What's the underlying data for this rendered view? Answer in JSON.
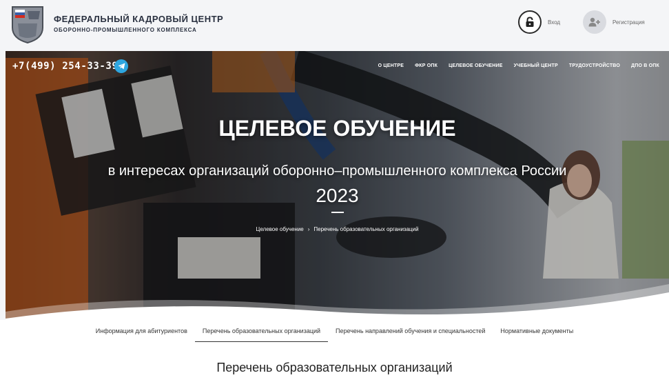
{
  "header": {
    "org_name_line1": "ФЕДЕРАЛЬНЫЙ КАДРОВЫЙ ЦЕНТР",
    "org_name_line2": "ОБОРОННО-ПРОМЫШЛЕННОГО КОМПЛЕКСА",
    "login_label": "Вход",
    "register_label": "Регистрация"
  },
  "hero": {
    "phone": "+7(499) 254-33-39",
    "nav": [
      "О ЦЕНТРЕ",
      "ФКР ОПК",
      "ЦЕЛЕВОЕ ОБУЧЕНИЕ",
      "УЧЕБНЫЙ ЦЕНТР",
      "ТРУДОУСТРОЙСТВО",
      "ДПО В ОПК"
    ],
    "title": "ЦЕЛЕВОЕ ОБУЧЕНИЕ",
    "subtitle": "в интересах организаций оборонно–промышленного комплекса России",
    "year": "2023",
    "breadcrumb": [
      "Целевое обучение",
      "›",
      "Перечень образовательных организаций"
    ]
  },
  "tabs": [
    "Информация для абитуриентов",
    "Перечень образовательных организаций",
    "Перечень направлений обучения и специальностей",
    "Нормативные документы"
  ],
  "active_tab_index": 1,
  "section": {
    "title": "Перечень образовательных организаций"
  },
  "colors": {
    "telegram": "#2ea6e0",
    "header_text": "#2a3140",
    "logo_blue": "#3b5fa8"
  },
  "icons": [
    "logo-emblem",
    "lock-icon",
    "add-user-icon",
    "telegram-icon"
  ]
}
